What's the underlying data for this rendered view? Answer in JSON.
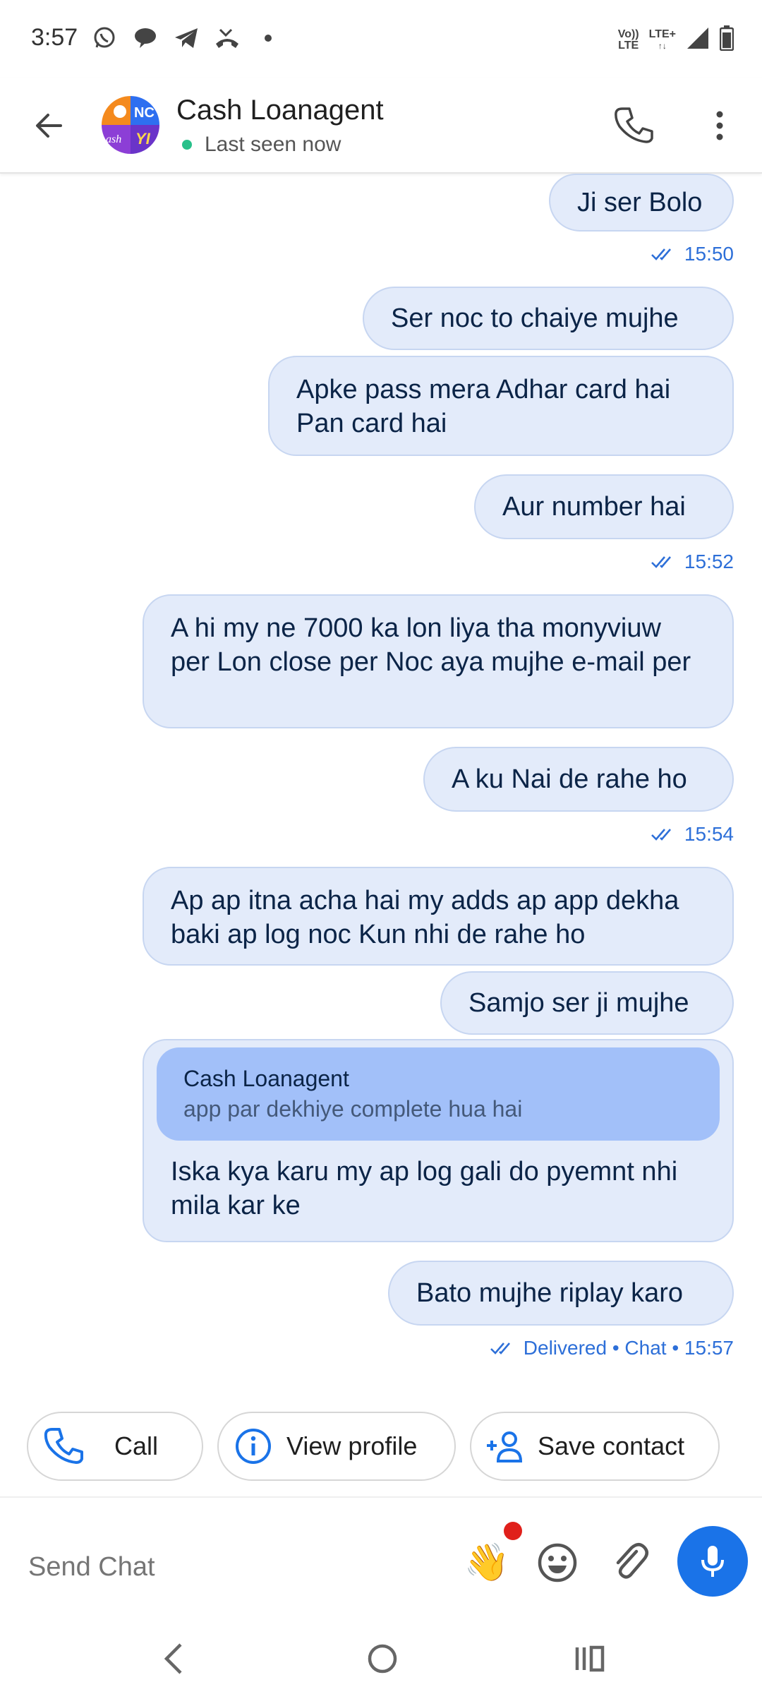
{
  "status_bar": {
    "time": "3:57",
    "lte_top": "Vo))",
    "lte_bottom": "LTE",
    "lte_plus": "LTE+"
  },
  "header": {
    "contact_name": "Cash Loanagent",
    "last_seen": "Last seen now"
  },
  "messages": [
    {
      "text": "Ji ser Bolo"
    },
    {
      "text": "Ser noc to chaiye mujhe"
    },
    {
      "text": "Apke pass mera Adhar card hai Pan card hai"
    },
    {
      "text": "Aur number hai"
    },
    {
      "text": "A hi my ne 7000 ka lon liya tha monyviuw per Lon close per Noc aya mujhe e-mail per"
    },
    {
      "text": "A ku Nai de rahe ho"
    },
    {
      "text": "Ap ap itna acha hai my adds ap app dekha baki ap log noc Kun nhi de rahe ho"
    },
    {
      "text": "Samjo ser ji mujhe"
    },
    {
      "text": "Bato mujhe riplay karo"
    }
  ],
  "timestamps": [
    "15:50",
    "15:52",
    "15:54",
    "Delivered • Chat • 15:57"
  ],
  "reply": {
    "quote_name": "Cash Loanagent",
    "quote_text": "app par dekhiye complete hua hai",
    "text": "Iska kya karu my ap log gali do pyemnt nhi mila kar ke"
  },
  "actions": {
    "call": "Call",
    "view_profile": "View profile",
    "save_contact": "Save contact"
  },
  "input": {
    "placeholder": "Send Chat"
  },
  "colors": {
    "bubble": "#e3ebfa",
    "quote": "#a2c0f9",
    "accent": "#1a73e8",
    "timestamp": "#2d6fd8"
  }
}
